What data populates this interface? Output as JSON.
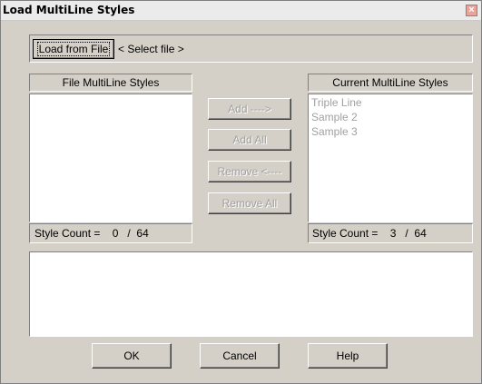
{
  "window": {
    "title": "Load MultiLine Styles",
    "close_glyph": "×"
  },
  "file_row": {
    "load_button": "Load from File",
    "selected_file": "< Select file >"
  },
  "file_panel": {
    "header": "File MultiLine Styles",
    "items": [],
    "count_label": "Style Count =    0   /  64"
  },
  "current_panel": {
    "header": "Current MultiLine Styles",
    "items": [
      "Triple Line",
      "Sample 2",
      "Sample 3"
    ],
    "count_label": "Style Count =    3   /  64"
  },
  "transfer": {
    "add": "Add  ---->",
    "add_all": "Add All",
    "remove": "Remove <----",
    "remove_all": "Remove All"
  },
  "message_area": "",
  "buttons": {
    "ok": "OK",
    "cancel": "Cancel",
    "help": "Help"
  }
}
